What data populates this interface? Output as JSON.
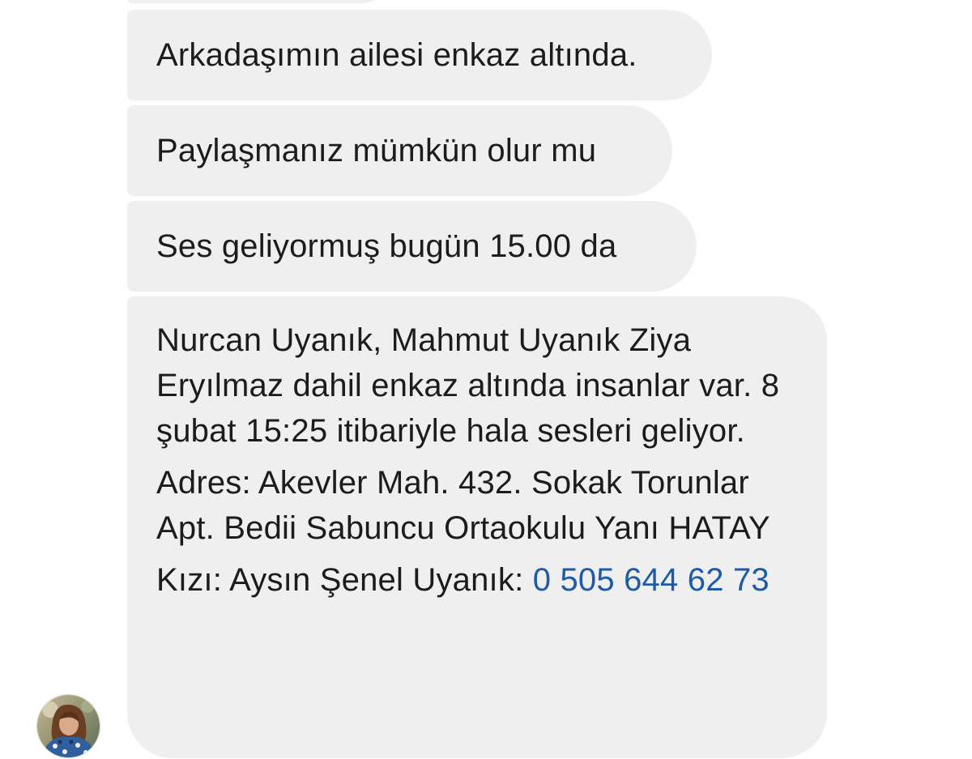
{
  "messages": [
    {
      "text": "Arkadaşımın ailesi enkaz altında."
    },
    {
      "text": "Paylaşmanız mümkün olur mu"
    },
    {
      "text": "Ses geliyormuş bugün 15.00 da"
    },
    {
      "paragraph_1": "Nurcan Uyanık, Mahmut Uyanık Ziya Eryılmaz dahil enkaz altında insanlar var. 8 şubat 15:25 itibariyle hala sesleri geliyor.",
      "paragraph_2": "Adres:  Akevler Mah. 432. Sokak Torunlar Apt. Bedii Sabuncu Ortaokulu Yanı HATAY",
      "paragraph_3_prefix": "Kızı: Aysın Şenel Uyanık: ",
      "phone_number": "0 505 644 62 73"
    }
  ],
  "sender": {
    "avatar_icon": "profile-photo"
  },
  "colors": {
    "bubble_background": "#efeff0",
    "text": "#1c1c1e",
    "link": "#1e5aa8",
    "page_background": "#ffffff"
  }
}
